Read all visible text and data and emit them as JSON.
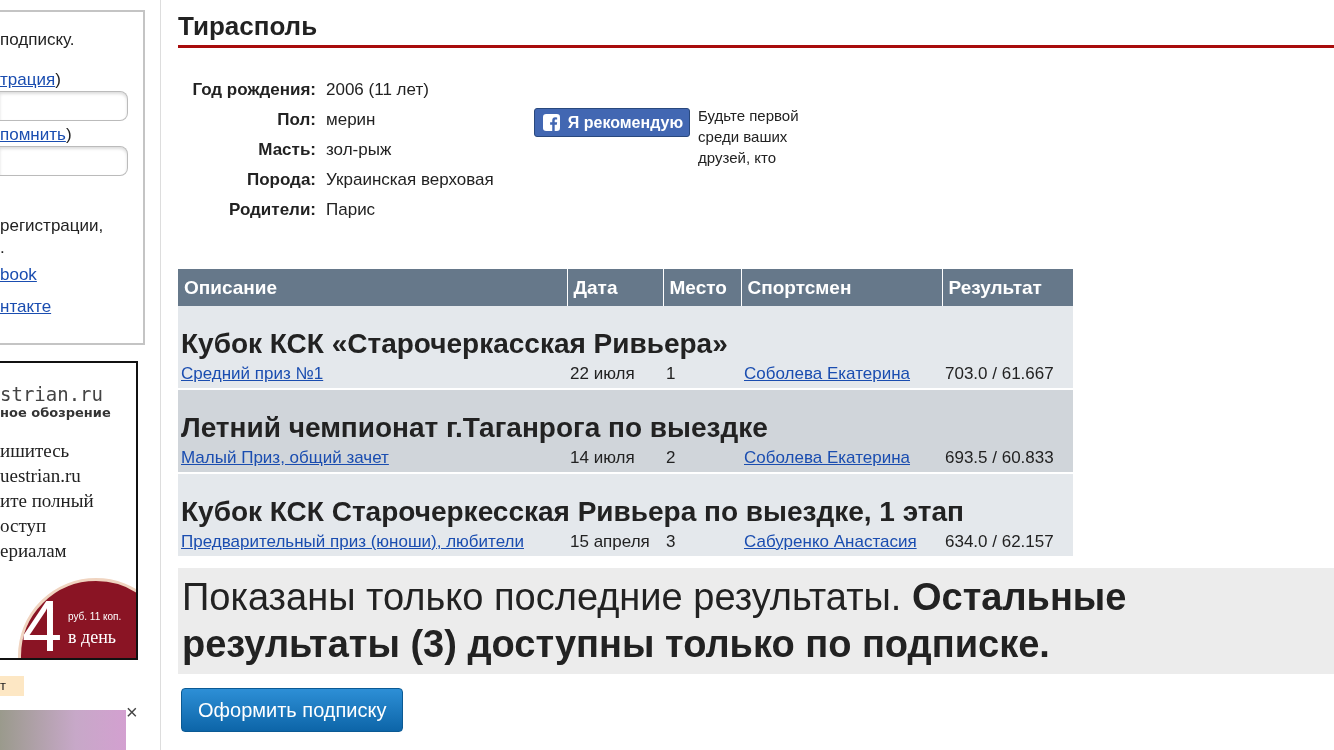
{
  "sidebar": {
    "login_text": "подписку.",
    "register_link": "трация",
    "register_suffix": ")",
    "forgot_link": "помнить",
    "forgot_suffix": ")",
    "social_text_1": "регистрации,",
    "social_text_2": ".",
    "facebook_link": "book",
    "vk_link": "нтакте"
  },
  "ad_banner": {
    "site": "strian.ru",
    "subtitle": "ное обозрение",
    "lines": [
      "ишитесь",
      "uestrian.ru",
      "ите полный",
      "оступ",
      "ериалам"
    ],
    "price": "4",
    "price_unit": "руб. 11 коп.",
    "per": "в день"
  },
  "tag": "т",
  "close": "×",
  "horse": {
    "name": "Тирасполь",
    "info": [
      {
        "label": "Год рождения:",
        "value": "2006 (11 лет)"
      },
      {
        "label": "Пол:",
        "value": "мерин"
      },
      {
        "label": "Масть:",
        "value": "зол-рыж"
      },
      {
        "label": "Порода:",
        "value": "Украинская верховая"
      },
      {
        "label": "Родители:",
        "value": "Парис"
      }
    ]
  },
  "recommend": {
    "button": "Я рекомендую",
    "text": "Будьте первой среди ваших друзей, кто"
  },
  "results": {
    "columns": [
      "Описание",
      "Дата",
      "Место",
      "Спортсмен",
      "Результат"
    ],
    "groups": [
      {
        "title": "Кубок КСК «Старочеркасская Ривьера»",
        "rows": [
          {
            "description": "Средний приз №1",
            "date": "22 июля",
            "place": "1",
            "rider": "Соболева Екатерина",
            "result": "703.0 / 61.667"
          }
        ]
      },
      {
        "title": "Летний чемпионат г.Таганрога по выездке",
        "rows": [
          {
            "description": "Малый Приз, общий зачет",
            "date": "14 июля",
            "place": "2",
            "rider": "Соболева Екатерина",
            "result": "693.5 / 60.833"
          }
        ]
      },
      {
        "title": "Кубок КСК Старочеркесская Ривьера по выездке, 1 этап",
        "rows": [
          {
            "description": "Предварительный приз (юноши), любители",
            "date": "15 апреля",
            "place": "3",
            "rider": "Сабуренко Анастасия",
            "result": "634.0 / 62.157"
          }
        ]
      }
    ]
  },
  "notice": "Показаны только последние результаты. **Остальные результаты (3) доступны только по подписке.**",
  "subscribe_button": "Оформить подписку"
}
